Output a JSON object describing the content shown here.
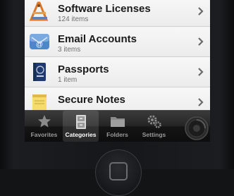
{
  "categories": [
    {
      "title": "Software Licenses",
      "count": "124 items",
      "icon": "software-licenses-icon"
    },
    {
      "title": "Email Accounts",
      "count": "3 items",
      "icon": "email-accounts-icon"
    },
    {
      "title": "Passports",
      "count": "1 item",
      "icon": "passports-icon"
    },
    {
      "title": "Secure Notes",
      "count": "",
      "icon": "secure-notes-icon"
    }
  ],
  "tabbar": {
    "favorites": "Favorites",
    "categories": "Categories",
    "folders": "Folders",
    "settings": "Settings",
    "active_tab": "Categories"
  },
  "colors": {
    "list_background": "#f4f4f4",
    "tabbar_background": "#1a1a1a",
    "active_tab_text": "#ffffff",
    "inactive_tab_text": "#9a9a9a"
  }
}
